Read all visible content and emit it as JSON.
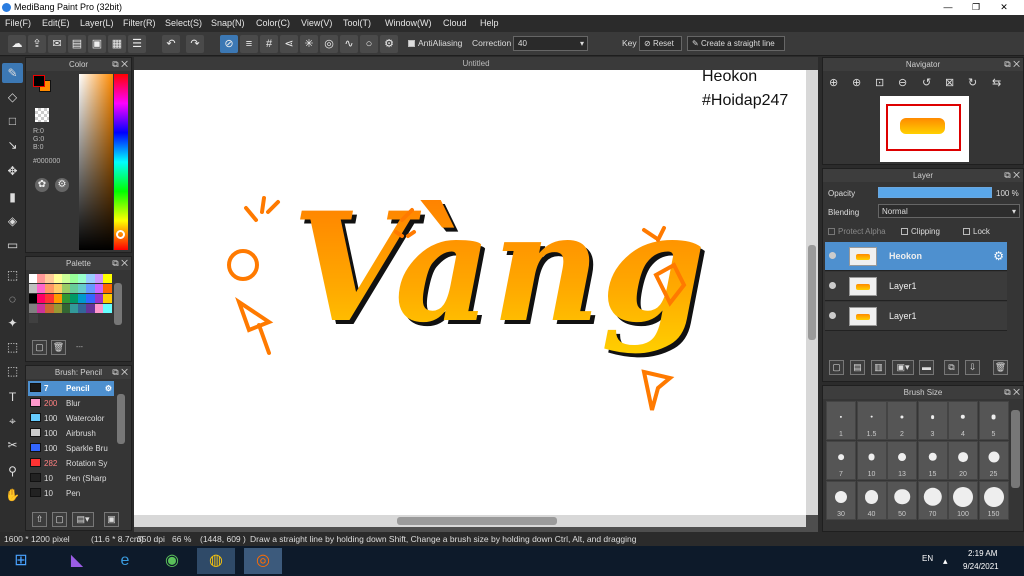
{
  "window": {
    "title": "MediBang Paint Pro (32bit)",
    "minimize": "—",
    "maximize": "❐",
    "close": "✕"
  },
  "menu": [
    "File(F)",
    "Edit(E)",
    "Layer(L)",
    "Filter(R)",
    "Select(S)",
    "Snap(N)",
    "Color(C)",
    "View(V)",
    "Tool(T)",
    "Window(W)",
    "Cloud",
    "Help"
  ],
  "toolbar": {
    "antialiasing": "AntiAliasing",
    "correction_label": "Correction",
    "correction_value": "40",
    "key_label": "Key",
    "reset_label": "Reset",
    "straight_line_label": "Create a straight line"
  },
  "color_panel": {
    "title": "Color",
    "r": "R:0",
    "g": "G:0",
    "b": "B:0",
    "hex": "#000000",
    "primary": "#000000",
    "secondary": "#ff8a00"
  },
  "palette_panel": {
    "title": "Palette",
    "more": "---",
    "colors": [
      "#ffffff",
      "#ff9999",
      "#ffcc99",
      "#ffff99",
      "#ccff99",
      "#99ff99",
      "#99ffcc",
      "#99ccff",
      "#cc99ff",
      "#ffff00",
      "#c0c0c0",
      "#ff66cc",
      "#ff9966",
      "#ffcc66",
      "#99cc66",
      "#66cc99",
      "#66cccc",
      "#6699ff",
      "#cc66ff",
      "#ff6600",
      "#000000",
      "#ff0066",
      "#ff3333",
      "#ff9900",
      "#339933",
      "#009966",
      "#0099cc",
      "#3366ff",
      "#9933cc",
      "#ffcc00",
      "#808080",
      "#cc3399",
      "#cc6633",
      "#999933",
      "#336633",
      "#339999",
      "#336699",
      "#663399",
      "#ff99cc",
      "#66ffff",
      "#404040"
    ]
  },
  "brush_panel": {
    "title": "Brush: Pencil",
    "brushes": [
      {
        "size": "7",
        "name": "Pencil",
        "color": "#1a1a1a",
        "selected": true
      },
      {
        "size": "200",
        "name": "Blur",
        "color": "#ff99cc"
      },
      {
        "size": "100",
        "name": "Watercolor",
        "color": "#66ccff"
      },
      {
        "size": "100",
        "name": "Airbrush",
        "color": "#cccccc"
      },
      {
        "size": "100",
        "name": "Sparkle Bru",
        "color": "#3366ff"
      },
      {
        "size": "282",
        "name": "Rotation Sy",
        "color": "#ff3333"
      },
      {
        "size": "10",
        "name": "Pen (Sharp",
        "color": "#222222"
      },
      {
        "size": "10",
        "name": "Pen",
        "color": "#222222"
      }
    ]
  },
  "document": {
    "tab_title": "Untitled",
    "watermark_line1": "Heokon",
    "watermark_line2": "#Hoidap247",
    "lettering": "Vàng"
  },
  "navigator": {
    "title": "Navigator"
  },
  "layer_panel": {
    "title": "Layer",
    "opacity_label": "Opacity",
    "opacity_value": "100 %",
    "opacity": 1.0,
    "blending_label": "Blending",
    "blending_value": "Normal",
    "protect_alpha": "Protect Alpha",
    "clipping": "Clipping",
    "lock": "Lock",
    "layers": [
      {
        "name": "Heokon",
        "selected": true
      },
      {
        "name": "Layer1",
        "selected": false
      },
      {
        "name": "Layer1",
        "selected": false
      }
    ]
  },
  "brush_size_panel": {
    "title": "Brush Size",
    "sizes": [
      "1",
      "1.5",
      "2",
      "3",
      "4",
      "5",
      "7",
      "10",
      "13",
      "15",
      "20",
      "25",
      "30",
      "40",
      "50",
      "70",
      "100",
      "150"
    ]
  },
  "status": {
    "pixels": "1600 * 1200 pixel",
    "cm": "(11.6 * 8.7cm)",
    "dpi": "350 dpi",
    "zoom": "66 %",
    "coords": "(1448, 609 )",
    "hint": "Draw a straight line by holding down Shift, Change a brush size by holding down Ctrl, Alt, and dragging"
  },
  "taskbar": {
    "lang": "EN",
    "time": "2:19 AM",
    "date": "9/24/2021"
  }
}
